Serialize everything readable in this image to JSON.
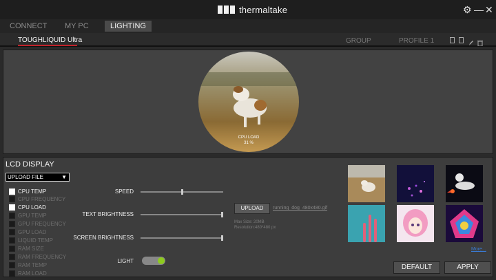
{
  "app": {
    "brand": "thermaltake",
    "window_controls": {
      "settings": "⚙",
      "minimize": "—",
      "close": "✕"
    }
  },
  "nav": {
    "tabs": [
      {
        "label": "CONNECT",
        "active": false
      },
      {
        "label": "MY PC",
        "active": false
      },
      {
        "label": "LIGHTING",
        "active": true
      }
    ]
  },
  "device": {
    "name": "TOUGHLIQUID Ultra",
    "group_label": "GROUP",
    "profile_label": "PROFILE 1",
    "tool_icons": [
      "save-icon",
      "copy-icon",
      "edit-icon",
      "delete-icon"
    ]
  },
  "preview": {
    "overlay_label": "CPU LOAD",
    "overlay_value": "31 %"
  },
  "lcd": {
    "section_title": "LCD DISPLAY",
    "mode_select": {
      "value": "UPLOAD FILE"
    },
    "metrics": [
      {
        "label": "CPU TEMP",
        "checked": true
      },
      {
        "label": "CPU FREQUENCY",
        "checked": false
      },
      {
        "label": "CPU LOAD",
        "checked": true
      },
      {
        "label": "GPU TEMP",
        "checked": false
      },
      {
        "label": "GPU FREQUENCY",
        "checked": false
      },
      {
        "label": "GPU LOAD",
        "checked": false
      },
      {
        "label": "LIQUID TEMP",
        "checked": false
      },
      {
        "label": "RAM SIZE",
        "checked": false
      },
      {
        "label": "RAM FREQUENCY",
        "checked": false
      },
      {
        "label": "RAM TEMP",
        "checked": false
      },
      {
        "label": "RAM LOAD",
        "checked": false
      }
    ],
    "sliders": [
      {
        "label": "SPEED",
        "value_fraction": 0.5
      },
      {
        "label": "TEXT BRIGHTNESS",
        "value_fraction": 1.0
      },
      {
        "label": "SCREEN BRIGHTNESS",
        "value_fraction": 1.0
      }
    ],
    "light_label": "LIGHT",
    "light_on": true,
    "upload_button": "UPLOAD",
    "file_name": "running_dog_480x480.gif",
    "max_size_hint": "Max Size: 20MB",
    "resolution_hint": "Resolution:480*480 px",
    "gallery": [
      "running-dog",
      "purple-particles",
      "astronaut-rocket",
      "coral-cyan",
      "anime-girl",
      "neon-wow"
    ],
    "more_link": "More..."
  },
  "actions": {
    "default_label": "DEFAULT",
    "apply_label": "APPLY"
  },
  "colors": {
    "accent_red": "#c2222a",
    "toggle_green": "#8ecb1e"
  }
}
